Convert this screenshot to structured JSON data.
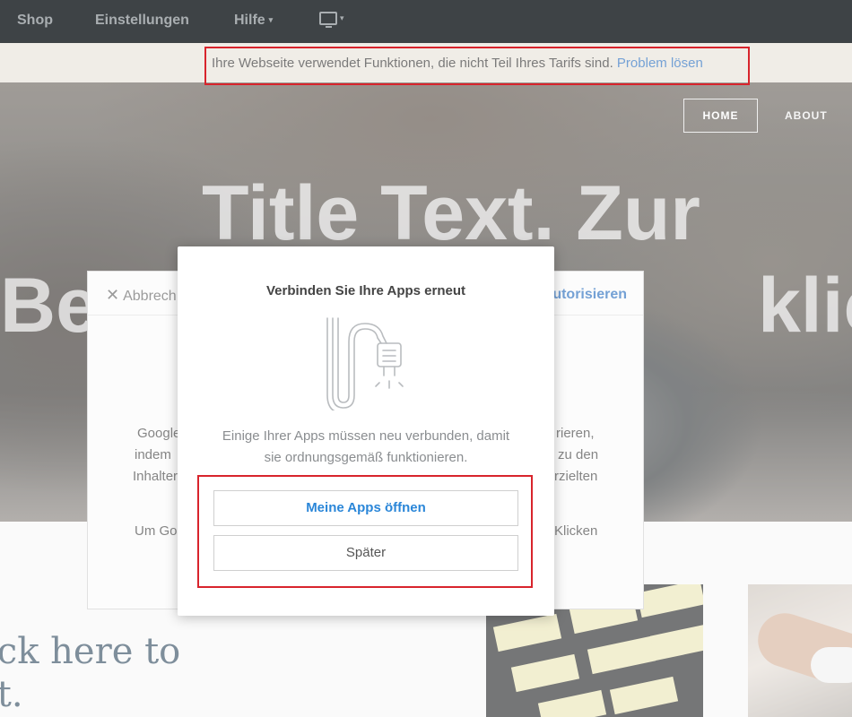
{
  "topbar": {
    "items": [
      {
        "label": "Shop"
      },
      {
        "label": "Einstellungen"
      },
      {
        "label": "Hilfe",
        "caret": "▾"
      }
    ],
    "device_icon": "monitor-icon",
    "device_caret": "▾"
  },
  "notice": {
    "text": "Ihre Webseite verwendet Funktionen, die nicht Teil Ihres Tarifs sind.",
    "link": "Problem lösen"
  },
  "hero": {
    "nav": {
      "home": "HOME",
      "about": "ABOUT"
    },
    "title_line1": "Title Text. Zur",
    "title_line2_left": "Be",
    "title_line2_right": "klicke"
  },
  "background_dialog": {
    "cancel": "Abbrech",
    "authorize": "utorisieren",
    "lines_left": [
      "Google",
      "indem",
      "Inhalter",
      "Um Go"
    ],
    "lines_right": [
      "rieren,",
      "zu den",
      "rzielten",
      "Klicken"
    ]
  },
  "modal": {
    "title": "Verbinden Sie Ihre Apps erneut",
    "icon": "plug-icon",
    "message_line1": "Einige Ihrer Apps müssen neu verbunden, damit",
    "message_line2": "sie ordnungsgemäß funktionieren.",
    "primary_button": "Meine Apps öffnen",
    "secondary_button": "Später"
  },
  "content": {
    "heading_line1": "ick here to",
    "heading_line2": "it."
  },
  "colors": {
    "topbar_bg": "#3e4346",
    "notice_bg": "#e9e3da",
    "link": "#2a6fbf",
    "primary_button_text": "#2a86d8",
    "highlight": "#d8242c"
  }
}
